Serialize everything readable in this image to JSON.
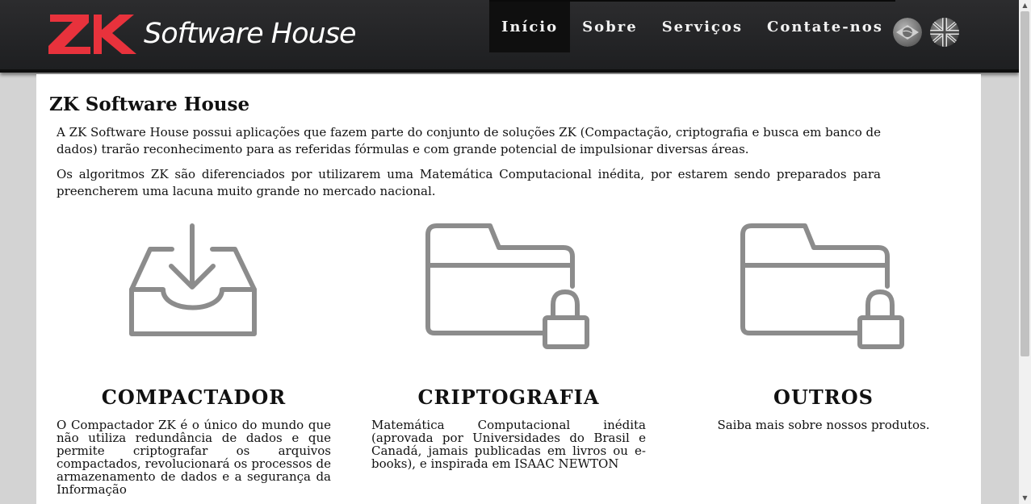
{
  "brand": {
    "text": "Software House",
    "logo_letters": "ZK",
    "logo_color": "#e8323c"
  },
  "nav": {
    "items": [
      {
        "label": "Início",
        "active": true
      },
      {
        "label": "Sobre",
        "active": false
      },
      {
        "label": "Serviços",
        "active": false
      },
      {
        "label": "Contate-nos",
        "active": false
      }
    ]
  },
  "languages": [
    {
      "icon": "brazil-flag-icon"
    },
    {
      "icon": "uk-flag-icon"
    }
  ],
  "main": {
    "title": "ZK Software House",
    "paragraphs": [
      "A ZK Software House possui aplicações que fazem parte do conjunto de soluções ZK (Compactação, criptografia e busca em banco de dados) trarão reconhecimento para as referidas fórmulas e com grande potencial de impulsionar diversas áreas.",
      "Os algoritmos ZK são diferenciados por utilizarem uma Matemática Computacional inédita, por estarem sendo preparados para preencherem uma lacuna muito grande no mercado nacional."
    ],
    "features": [
      {
        "icon": "inbox-download-icon",
        "title": "COMPACTADOR",
        "text": "O Compactador ZK é o único do mundo que não utiliza redundância de dados e que permite criptografar os arquivos compactados, revolucionará os processos de armazenamento de dados e a segurança da Informação"
      },
      {
        "icon": "folder-lock-icon",
        "title": "CRIPTOGRAFIA",
        "text": "Matemática Computacional inédita (aprovada por Universidades do Brasil e Canadá, jamais publicadas em livros ou e-books), e inspirada em ISAAC NEWTON"
      },
      {
        "icon": "folder-lock-icon",
        "title": "OUTROS",
        "text": "Saiba mais sobre nossos produtos."
      }
    ]
  },
  "colors": {
    "header_bg": "#232426",
    "icon_gray": "#8c8c8c",
    "page_bg": "#d3d3d3"
  }
}
